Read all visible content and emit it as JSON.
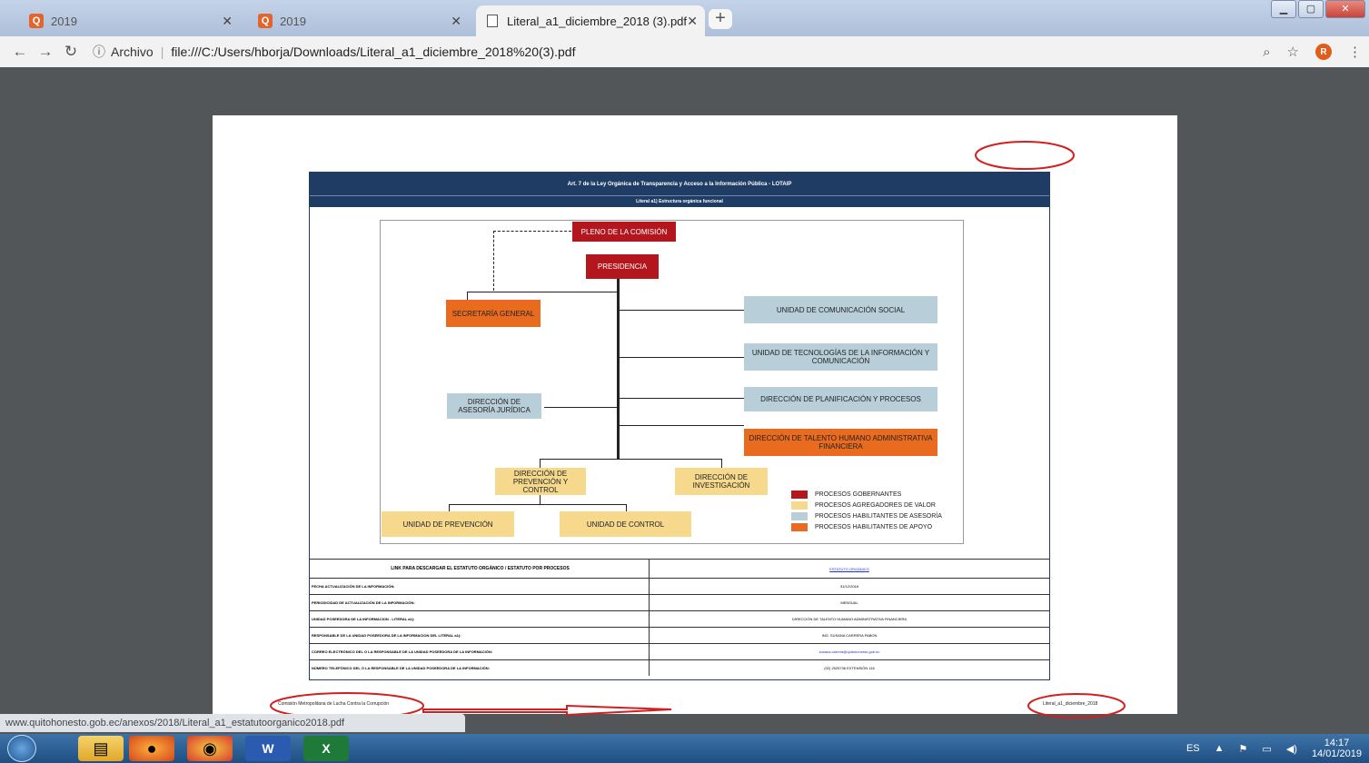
{
  "tabs": [
    {
      "title": "2019"
    },
    {
      "title": "2019"
    },
    {
      "title": "Literal_a1_diciembre_2018 (3).pdf"
    }
  ],
  "toolbar": {
    "info_label": "Archivo",
    "url": "file:///C:/Users/hborja/Downloads/Literal_a1_diciembre_2018%20(3).pdf",
    "avatar_letter": "R"
  },
  "doc": {
    "header_title": "Art. 7 de la Ley Orgánica de Transparencia y Acceso a la Información Pública - LOTAIP",
    "header_subtitle": "Literal a1) Estructura orgánica funcional",
    "org": {
      "pleno": "PLENO DE LA COMISIÓN",
      "presidencia": "PRESIDENCIA",
      "secretaria": "SECRETARÍA GENERAL",
      "comunicacion": "UNIDAD DE COMUNICACIÓN SOCIAL",
      "tecnologias": "UNIDAD DE TECNOLOGÍAS DE LA INFORMACIÓN Y COMUNICACIÓN",
      "juridica": "DIRECCIÓN DE ASESORÍA JURÍDICA",
      "planificacion": "DIRECCIÓN DE PLANIFICACIÓN Y PROCESOS",
      "talento": "DIRECCIÓN DE TALENTO HUMANO ADMINISTRATIVA FINANCIERA",
      "prevencion_dir": "DIRECCIÓN DE PREVENCIÓN Y CONTROL",
      "investigacion": "DIRECCIÓN DE INVESTIGACIÓN",
      "unidad_prevencion": "UNIDAD DE PREVENCIÓN",
      "unidad_control": "UNIDAD DE CONTROL"
    },
    "legend": [
      {
        "label": "PROCESOS GOBERNANTES",
        "color": "#b3161d"
      },
      {
        "label": "PROCESOS AGREGADORES DE VALOR",
        "color": "#f6d98c"
      },
      {
        "label": "PROCESOS HABILITANTES DE ASESORÍA",
        "color": "#b8cfd9"
      },
      {
        "label": "PROCESOS HABILITANTES DE APOYO",
        "color": "#e86b1f"
      }
    ],
    "table": [
      {
        "label": "LINK PARA DESCARGAR EL ESTATUTO ORGÁNICO / ESTATUTO POR PROCESOS",
        "value": "ESTATUTO ORGÁNICO"
      },
      {
        "label": "FECHA ACTUALIZACIÓN DE LA INFORMACIÓN:",
        "value": "31/12/2018"
      },
      {
        "label": "PERIODICIDAD DE ACTUALIZACIÓN DE LA INFORMACIÓN:",
        "value": "MENSUAL"
      },
      {
        "label": "UNIDAD POSEEDORA DE LA INFORMACION - LITERAL a1):",
        "value": "DIRECCIÓN DE TALENTO HUMANO ADMINISTRATIVA FINANCIERA"
      },
      {
        "label": "RESPONSABLE DE LA UNIDAD POSEEDORA DE LA INFORMACION DEL LITERAL a1):",
        "value": "ING. SUSANA CARRERA PABON"
      },
      {
        "label": "CORREO ELECTRÓNICO DEL O LA RESPONSABLE DE LA UNIDAD POSEEDORA DE LA INFORMACIÓN:",
        "value": "susana.carrera@quitohonesto.gob.ec"
      },
      {
        "label": "NÚMERO TELEFÓNICO DEL O LA RESPONSABLE DE LA UNIDAD POSEEDORA DE LA INFORMACIÓN:",
        "value": "(02) 2525736 EXTENSIÓN 116"
      }
    ],
    "footer_left": "Comisión Metropolitana de Lucha Contra la Corrupción",
    "footer_right": "Literal_a1_diciembre_2018"
  },
  "status_url": "www.quitohonesto.gob.ec/anexos/2018/Literal_a1_estatutoorganico2018.pdf",
  "tray": {
    "lang": "ES",
    "time": "14:17",
    "date": "14/01/2019"
  }
}
